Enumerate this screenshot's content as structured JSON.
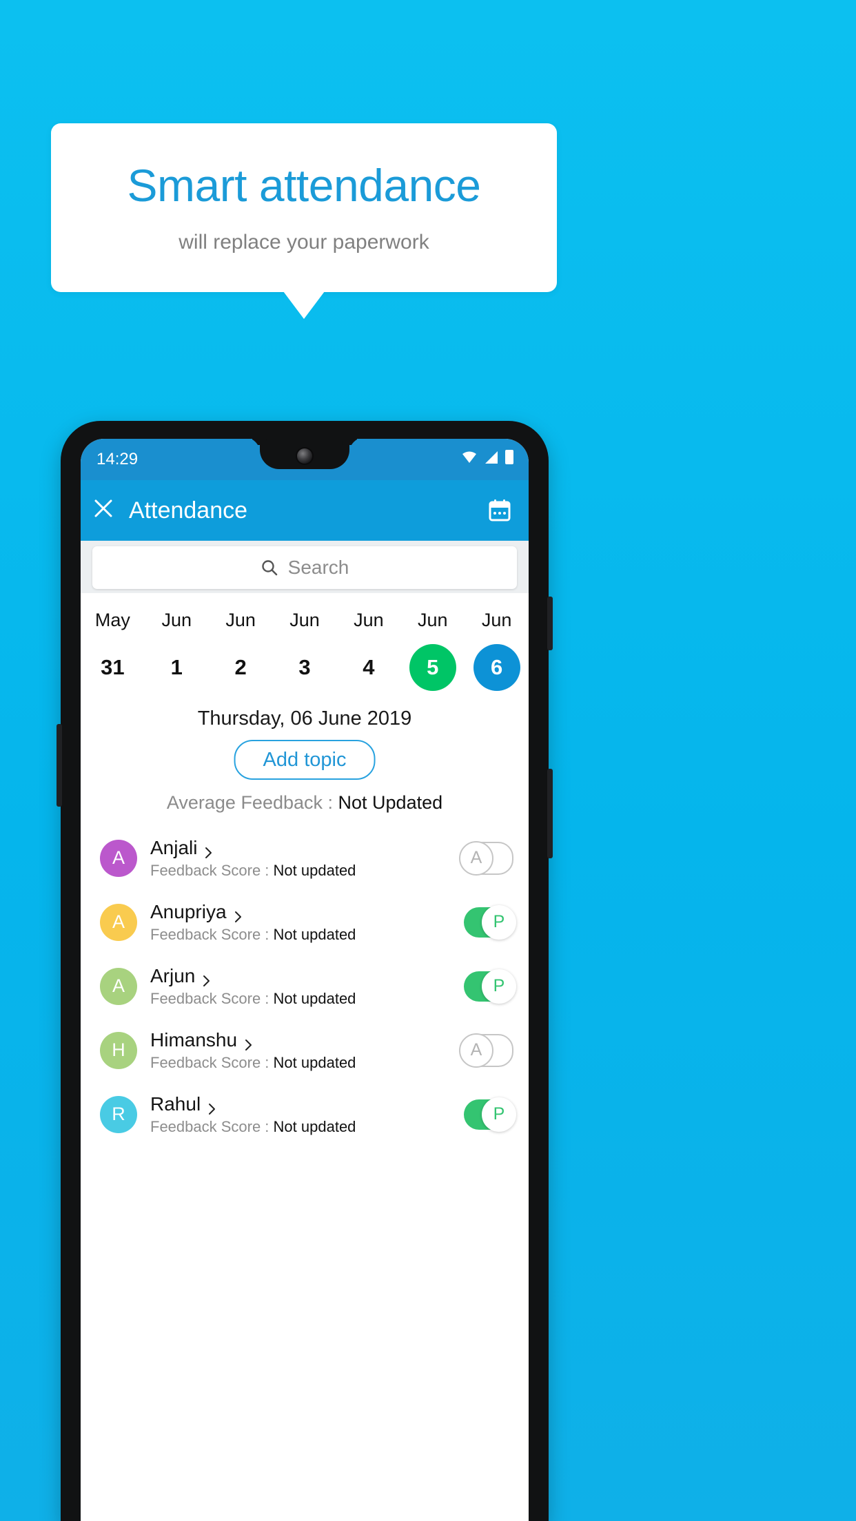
{
  "promo": {
    "title": "Smart attendance",
    "subtitle": "will replace your paperwork"
  },
  "colors": {
    "background": "#0cbdee",
    "accent": "#1b9bd8",
    "appbar": "#0e9ddb",
    "statusbar": "#1a8fcf",
    "present": "#34c471",
    "today": "#0d92d6",
    "selected_green": "#00c566"
  },
  "phone": {
    "status_bar": {
      "time": "14:29",
      "icons": [
        "wifi-icon",
        "signal-icon",
        "battery-icon"
      ]
    },
    "app_bar": {
      "close_icon": "close-icon",
      "title": "Attendance",
      "calendar_icon": "calendar-icon"
    },
    "search": {
      "icon": "search-icon",
      "placeholder": "Search",
      "value": ""
    },
    "date_strip": [
      {
        "month": "May",
        "day": "31",
        "state": "normal"
      },
      {
        "month": "Jun",
        "day": "1",
        "state": "normal"
      },
      {
        "month": "Jun",
        "day": "2",
        "state": "normal"
      },
      {
        "month": "Jun",
        "day": "3",
        "state": "normal"
      },
      {
        "month": "Jun",
        "day": "4",
        "state": "normal"
      },
      {
        "month": "Jun",
        "day": "5",
        "state": "green"
      },
      {
        "month": "Jun",
        "day": "6",
        "state": "blue"
      }
    ],
    "full_date": "Thursday, 06 June 2019",
    "add_topic_label": "Add topic",
    "average_feedback": {
      "label": "Average Feedback : ",
      "value": "Not Updated"
    },
    "feedback_label": "Feedback Score : ",
    "students": [
      {
        "name": "Anjali",
        "initial": "A",
        "avatar_color": "#bb58cc",
        "feedback": "Not updated",
        "attendance": "A",
        "present": false
      },
      {
        "name": "Anupriya",
        "initial": "A",
        "avatar_color": "#f9cb4f",
        "feedback": "Not updated",
        "attendance": "P",
        "present": true
      },
      {
        "name": "Arjun",
        "initial": "A",
        "avatar_color": "#a8d27f",
        "feedback": "Not updated",
        "attendance": "P",
        "present": true
      },
      {
        "name": "Himanshu",
        "initial": "H",
        "avatar_color": "#a8d27f",
        "feedback": "Not updated",
        "attendance": "A",
        "present": false
      },
      {
        "name": "Rahul",
        "initial": "R",
        "avatar_color": "#49cbe4",
        "feedback": "Not updated",
        "attendance": "P",
        "present": true
      }
    ]
  }
}
